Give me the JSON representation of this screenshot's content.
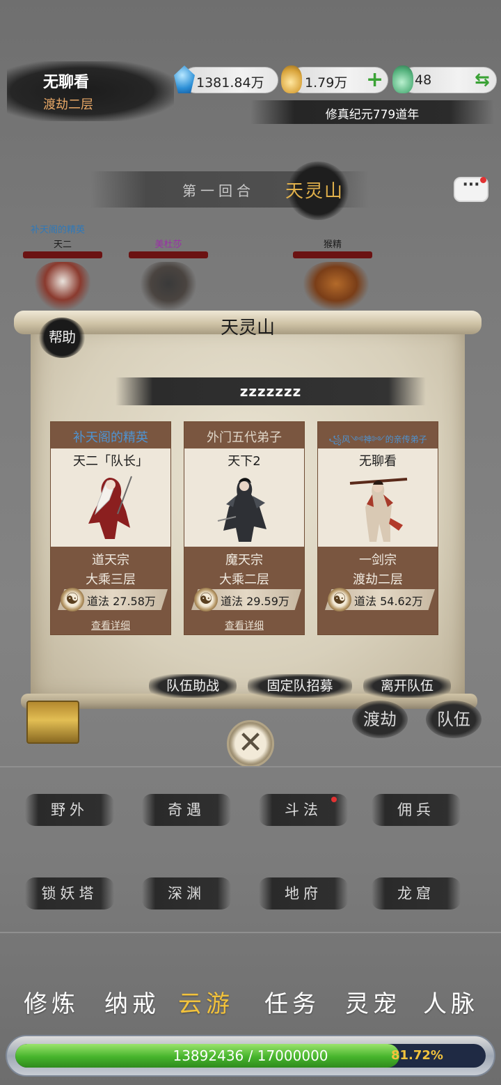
{
  "player": {
    "name": "无聊看",
    "realm": "渡劫二层"
  },
  "currencies": {
    "spirit_stone": "1381.84万",
    "gold": "1.79万",
    "jade": "48"
  },
  "era": "修真纪元779道年",
  "battle": {
    "round": "第一回合",
    "location": "天灵山",
    "units": [
      {
        "sect": "补天阁的精英",
        "name": "天二"
      },
      {
        "name": "美杜莎"
      },
      {
        "name": "猴精"
      }
    ]
  },
  "dialog": {
    "title": "天灵山",
    "help": "帮助",
    "team_name": "zzzzzzz",
    "members": [
      {
        "sect": "补天阁的精英",
        "name": "天二「队长」",
        "school": "道天宗",
        "level": "大乘三层",
        "power": "道法 27.58万",
        "detail": "查看详细"
      },
      {
        "sect": "外门五代弟子",
        "name": "天下2",
        "school": "魔天宗",
        "level": "大乘二层",
        "power": "道法 29.59万",
        "detail": "查看详细"
      },
      {
        "sect": "꧁风༺神༻的亲传弟子",
        "name": "无聊看",
        "school": "一剑宗",
        "level": "渡劫二层",
        "power": "道法 54.62万"
      }
    ],
    "buttons": {
      "assist": "队伍助战",
      "recruit": "固定队招募",
      "leave": "离开队伍"
    }
  },
  "side_buttons": {
    "tribulation": "渡劫",
    "team": "队伍"
  },
  "activities": [
    "野外",
    "奇遇",
    "斗法",
    "佣兵",
    "锁妖塔",
    "深渊",
    "地府",
    "龙窟"
  ],
  "nav": [
    "修炼",
    "纳戒",
    "云游",
    "任务",
    "灵宠",
    "人脉"
  ],
  "nav_active": "云游",
  "exp": {
    "text": "13892436 / 17000000",
    "percent": "81.72%",
    "fraction": 0.8172
  },
  "colors": {
    "accent_gold": "#f2c23c",
    "exp_green": "#46b42c",
    "plus_green": "#3aa235",
    "hp_red": "#6b1212"
  }
}
